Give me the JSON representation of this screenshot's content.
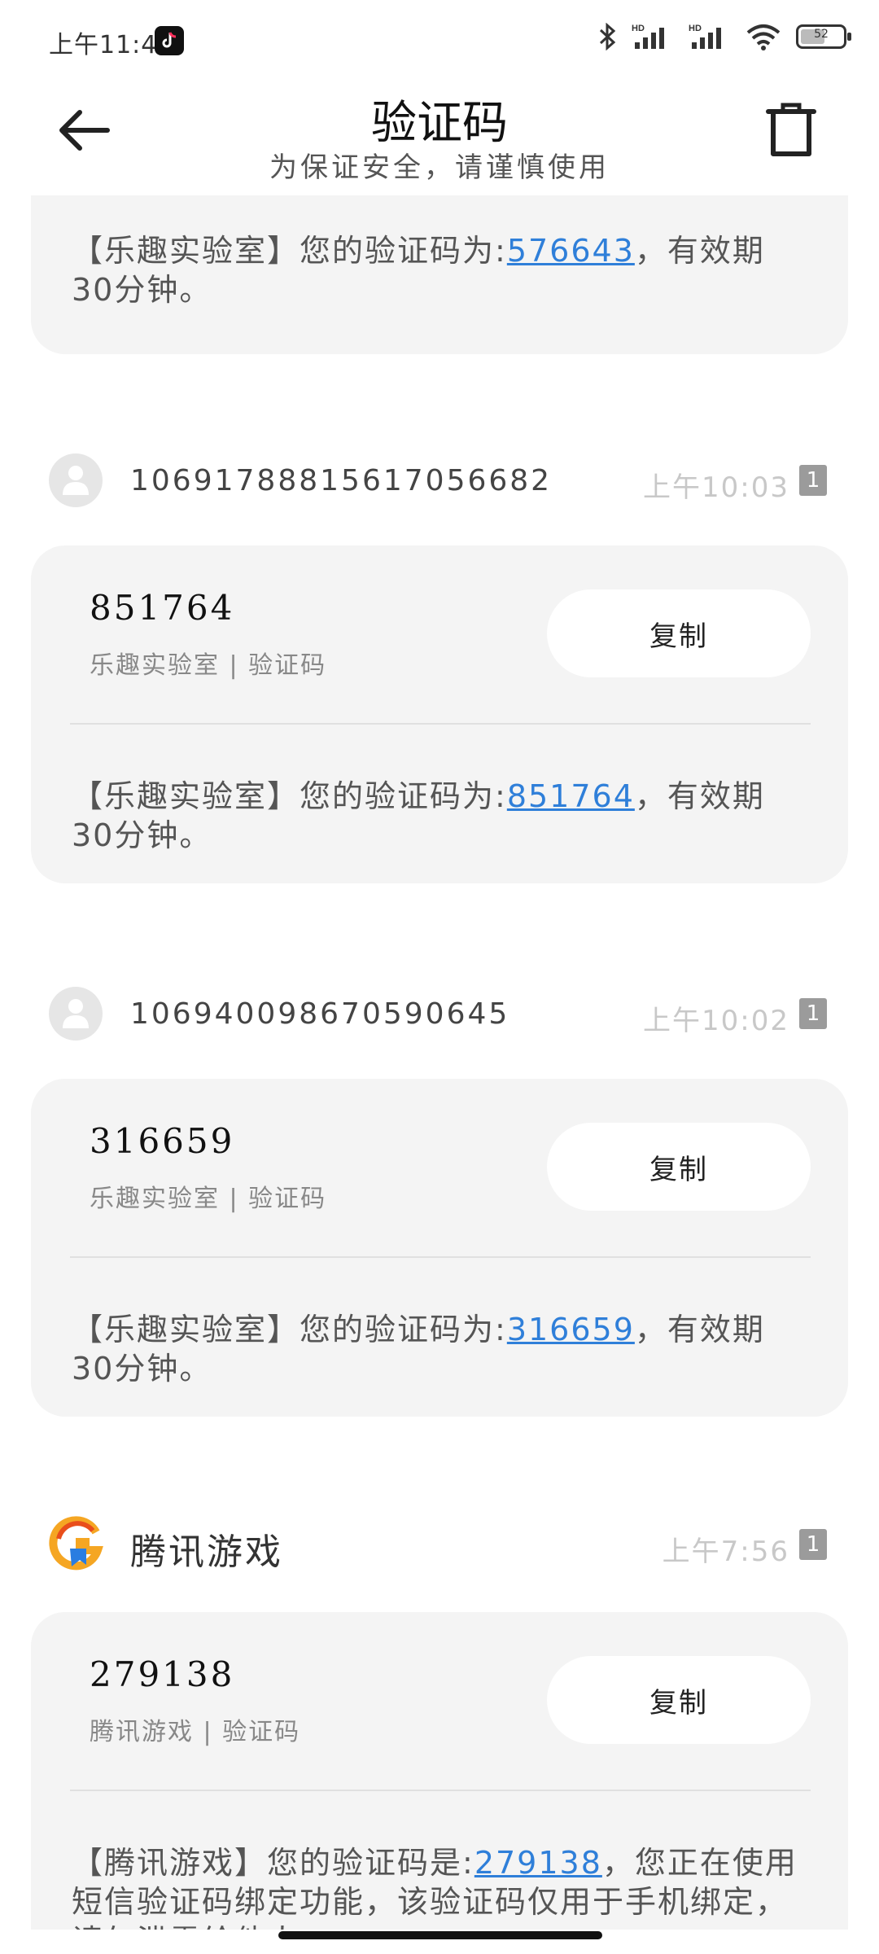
{
  "status_bar": {
    "time": "上午11:47",
    "battery": "52",
    "battery_level": 0.52,
    "icons": [
      "tiktok-icon",
      "bluetooth-icon",
      "signal-hd-icon",
      "signal-hd-icon",
      "wifi-icon",
      "battery-icon"
    ]
  },
  "header": {
    "title": "验证码",
    "subtitle": "为保证安全，请谨慎使用"
  },
  "messages": [
    {
      "text_prefix": "【乐趣实验室】您的验证码为:",
      "code": "576643",
      "text_suffix": "，有效期30分钟。"
    },
    {
      "sender": "106917888156170566",
      "sender_full": "10691788815617056682",
      "time": "上午10:03",
      "sim": "1",
      "code": "851764",
      "source": "乐趣实验室 | 验证码",
      "copy_label": "复制",
      "text_prefix": "【乐趣实验室】您的验证码为:",
      "text_suffix": "，有效期30分钟。"
    },
    {
      "sender": "10694009867059064",
      "sender_full": "106940098670590645",
      "time": "上午10:02",
      "sim": "1",
      "code": "316659",
      "source": "乐趣实验室 | 验证码",
      "copy_label": "复制",
      "text_prefix": "【乐趣实验室】您的验证码为:",
      "text_suffix": "，有效期30分钟。"
    },
    {
      "sender": "腾讯游戏",
      "time": "上午7:56",
      "sim": "1",
      "code": "279138",
      "source": "腾讯游戏 | 验证码",
      "copy_label": "复制",
      "text_prefix": "【腾讯游戏】您的验证码是:",
      "text_suffix": "，您正在使用短信验证码绑定功能，该验证码仅用于手机绑定，请勿泄露给他人。"
    }
  ]
}
